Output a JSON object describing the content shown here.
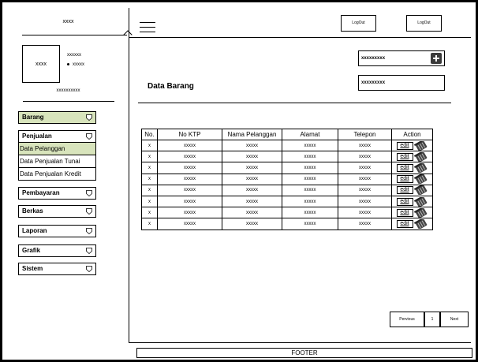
{
  "brand": "xxxx",
  "profile": {
    "avatar_text": "xxxx",
    "name": "xxxxxx",
    "status": "xxxxx",
    "subtitle": "xxxxxxxxxx"
  },
  "menu": {
    "barang": "Barang",
    "penjualan": "Penjualan",
    "submenu": [
      "Data Pelanggan",
      "Data Penjualan Tunai",
      "Data Penjualan Kredit"
    ],
    "pembayaran": "Pembayaran",
    "berkas": "Berkas",
    "laporan": "Laporan",
    "grafik": "Grafik",
    "sistem": "Sistem"
  },
  "header": {
    "logout_1": "LogOut",
    "logout_2": "LogOut"
  },
  "page_title": "Data Barang",
  "fields": {
    "field_1": "xxxxxxxxx",
    "field_2": "xxxxxxxxx"
  },
  "table": {
    "headers": [
      "No.",
      "No KTP",
      "Nama Pelanggan",
      "Alamat",
      "Telepon",
      "Action"
    ],
    "edit_label": "edit",
    "rows": [
      [
        "x",
        "xxxxx",
        "xxxxx",
        "xxxxx",
        "xxxxx"
      ],
      [
        "x",
        "xxxxx",
        "xxxxx",
        "xxxxx",
        "xxxxx"
      ],
      [
        "x",
        "xxxxx",
        "xxxxx",
        "xxxxx",
        "xxxxx"
      ],
      [
        "x",
        "xxxxx",
        "xxxxx",
        "xxxxx",
        "xxxxx"
      ],
      [
        "x",
        "xxxxx",
        "xxxxx",
        "xxxxx",
        "xxxxx"
      ],
      [
        "x",
        "xxxxx",
        "xxxxx",
        "xxxxx",
        "xxxxx"
      ],
      [
        "x",
        "xxxxx",
        "xxxxx",
        "xxxxx",
        "xxxxx"
      ],
      [
        "x",
        "xxxxx",
        "xxxxx",
        "xxxxx",
        "xxxxx"
      ]
    ]
  },
  "pagination": {
    "previous": "Pervious",
    "page": "1",
    "next": "Next"
  },
  "footer": "FOOTER",
  "colors": {
    "selected_fill": "#d8e4bc",
    "add_button": "#3a3a3a"
  }
}
